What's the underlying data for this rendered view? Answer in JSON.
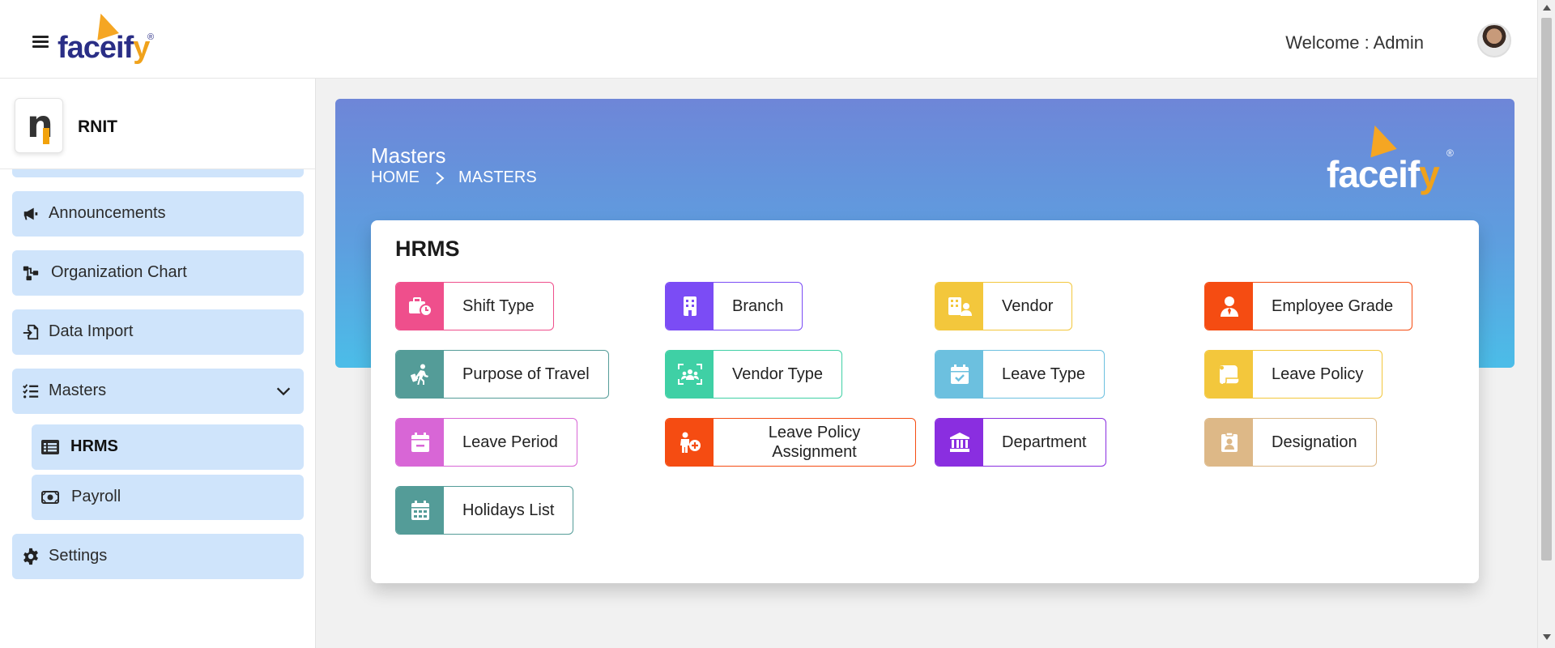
{
  "header": {
    "brand": "faceif",
    "brand_y": "y",
    "brand_reg": "®",
    "welcome": "Welcome : Admin"
  },
  "sidebar": {
    "org_name": "RNIT",
    "items": [
      {
        "label": "Announcements",
        "icon": "megaphone-icon"
      },
      {
        "label": "Organization Chart",
        "icon": "org-chart-icon"
      },
      {
        "label": "Data Import",
        "icon": "file-import-icon"
      },
      {
        "label": "Masters",
        "icon": "list-check-icon",
        "expanded": true
      },
      {
        "label": "Settings",
        "icon": "gear-icon"
      }
    ],
    "sub_items": [
      {
        "label": "HRMS",
        "icon": "list-icon",
        "active": true
      },
      {
        "label": "Payroll",
        "icon": "money-bill-icon",
        "active": false
      }
    ]
  },
  "banner": {
    "title": "Masters",
    "breadcrumb": [
      "HOME",
      "MASTERS"
    ],
    "logo_text": "faceif",
    "logo_y": "y",
    "logo_reg": "®"
  },
  "card": {
    "title": "HRMS",
    "tiles": [
      {
        "label": "Shift Type",
        "color": "#ef4f8c",
        "icon": "briefcase-clock-icon"
      },
      {
        "label": "Branch",
        "color": "#7b4cf5",
        "icon": "building-icon"
      },
      {
        "label": "Vendor",
        "color": "#f3c73c",
        "icon": "building-user-icon"
      },
      {
        "label": "Employee Grade",
        "color": "#f54c12",
        "icon": "user-tie-icon"
      },
      {
        "label": "Purpose of Travel",
        "color": "#549c98",
        "icon": "person-walking-luggage-icon"
      },
      {
        "label": "Vendor Type",
        "color": "#3fd0a5",
        "icon": "users-viewfinder-icon"
      },
      {
        "label": "Leave Type",
        "color": "#6cc0df",
        "icon": "calendar-check-icon"
      },
      {
        "label": "Leave Policy",
        "color": "#f3c73c",
        "icon": "scroll-icon"
      },
      {
        "label": "Leave Period",
        "color": "#d866d6",
        "icon": "calendar-minus-icon"
      },
      {
        "label": "Leave Policy Assignment",
        "color": "#f54c12",
        "icon": "person-circle-plus-icon"
      },
      {
        "label": "Department",
        "color": "#8a2ee0",
        "icon": "landmark-icon"
      },
      {
        "label": "Designation",
        "color": "#ddb887",
        "icon": "clipboard-user-icon"
      },
      {
        "label": "Holidays List",
        "color": "#549c98",
        "icon": "calendar-days-icon"
      }
    ]
  }
}
